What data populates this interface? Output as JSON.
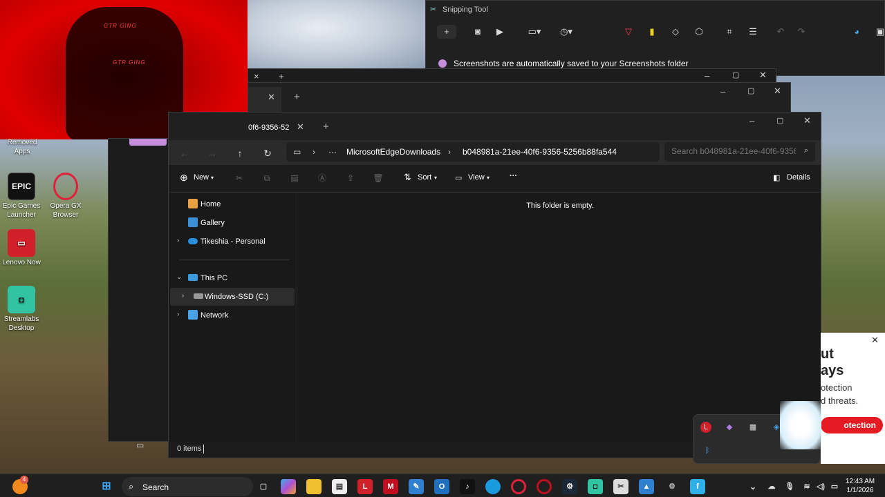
{
  "desktop": {
    "icons": [
      {
        "label": "Removed Apps"
      },
      {
        "label": "Epic Games Launcher"
      },
      {
        "label": "Opera GX Browser"
      },
      {
        "label": "Lenovo Now"
      },
      {
        "label": "Streamlabs Desktop"
      }
    ],
    "webcam_text": "GTR GING"
  },
  "snipping_tool": {
    "title": "Snipping Tool",
    "banner": "Screenshots are automatically saved to your Screenshots folder"
  },
  "explorer": {
    "tab_label": "0f6-9356-52",
    "tab_add": "+",
    "breadcrumbs": [
      "MicrosoftEdgeDownloads",
      "b048981a-21ee-40f6-9356-5256b88fa544"
    ],
    "search_placeholder": "Search b048981a-21ee-40f6-9356",
    "toolbar": {
      "new_label": "New",
      "sort_label": "Sort",
      "view_label": "View",
      "more_label": "···",
      "details_label": "Details"
    },
    "sidebar": {
      "home": "Home",
      "gallery": "Gallery",
      "onedrive": "Tikeshia - Personal",
      "this_pc": "This PC",
      "drive": "Windows-SSD (C:)",
      "network": "Network"
    },
    "empty_message": "This folder is empty.",
    "status": "0 items"
  },
  "promo": {
    "line1": "ut",
    "line2": "ays",
    "line3": "otection",
    "line4": "d threats.",
    "button": "otection"
  },
  "taskbar": {
    "search_label": "Search",
    "time": "12:43 AM",
    "date": "1/1/2026",
    "notification_count": "4"
  },
  "colors": {
    "explorer_bg": "#191919",
    "accent_red": "#e41b23",
    "taskbar_bg": "#1f1f1f"
  }
}
